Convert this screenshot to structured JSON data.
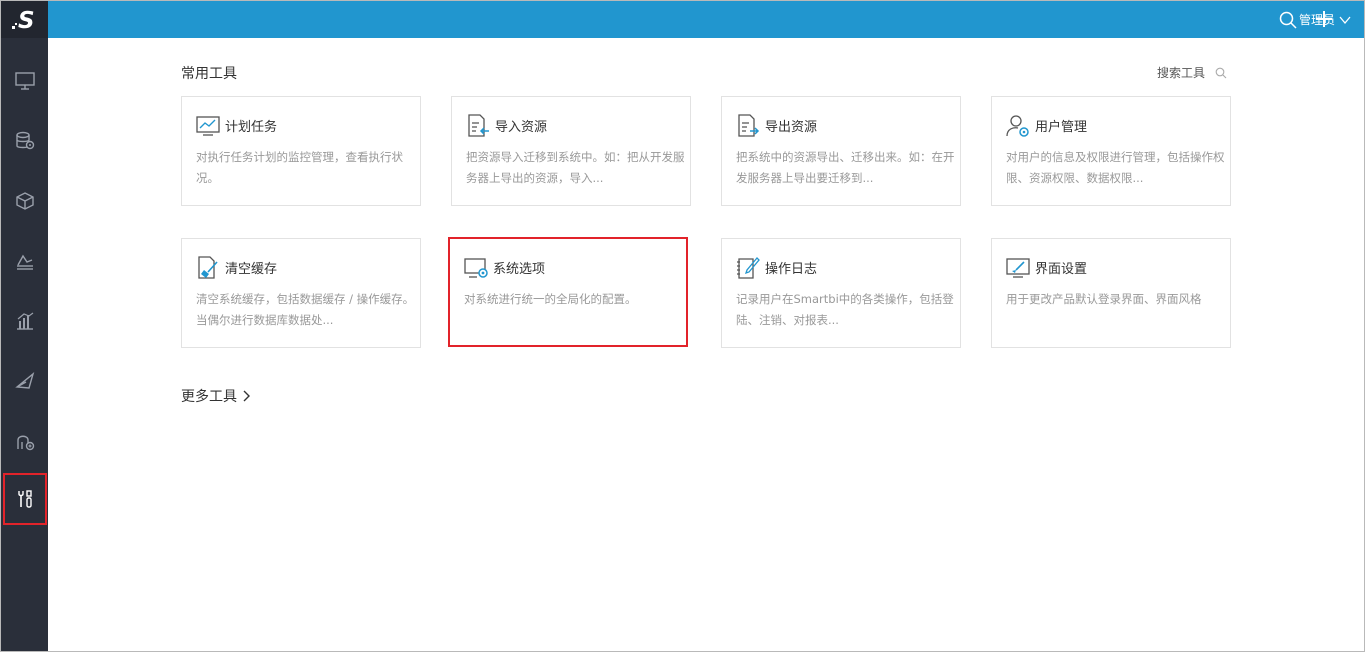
{
  "app": {
    "logo_text": "S"
  },
  "sidebar": {
    "items": [
      {
        "icon": "monitor-icon"
      },
      {
        "icon": "database-settings-icon"
      },
      {
        "icon": "cube-icon"
      },
      {
        "icon": "layers-chart-icon"
      },
      {
        "icon": "bar-chart-icon"
      },
      {
        "icon": "send-icon"
      },
      {
        "icon": "user-plus-icon"
      },
      {
        "icon": "tools-icon",
        "active": true
      }
    ]
  },
  "topbar": {
    "user_label": "管理员"
  },
  "main": {
    "section_title": "常用工具",
    "search_label": "搜索工具",
    "more_tools_label": "更多工具",
    "cards": [
      {
        "title": "计划任务",
        "desc": "对执行任务计划的监控管理，查看执行状况。",
        "icon": "schedule-icon"
      },
      {
        "title": "导入资源",
        "desc": "把资源导入迁移到系统中。如：把从开发服务器上导出的资源，导入...",
        "icon": "import-icon"
      },
      {
        "title": "导出资源",
        "desc": "把系统中的资源导出、迁移出来。如：在开发服务器上导出要迁移到...",
        "icon": "export-icon"
      },
      {
        "title": "用户管理",
        "desc": "对用户的信息及权限进行管理，包括操作权限、资源权限、数据权限...",
        "icon": "user-management-icon"
      },
      {
        "title": "清空缓存",
        "desc": "清空系统缓存，包括数据缓存 / 操作缓存。当偶尔进行数据库数据处...",
        "icon": "clear-cache-icon"
      },
      {
        "title": "系统选项",
        "desc": "对系统进行统一的全局化的配置。",
        "icon": "system-options-icon"
      },
      {
        "title": "操作日志",
        "desc": "记录用户在Smartbi中的各类操作，包括登陆、注销、对报表...",
        "icon": "operation-log-icon"
      },
      {
        "title": "界面设置",
        "desc": "用于更改产品默认登录界面、界面风格",
        "icon": "interface-settings-icon"
      }
    ]
  },
  "colors": {
    "topbar": "#2196cf",
    "sidebar": "#2a2f3a",
    "highlight": "#e2232a"
  }
}
